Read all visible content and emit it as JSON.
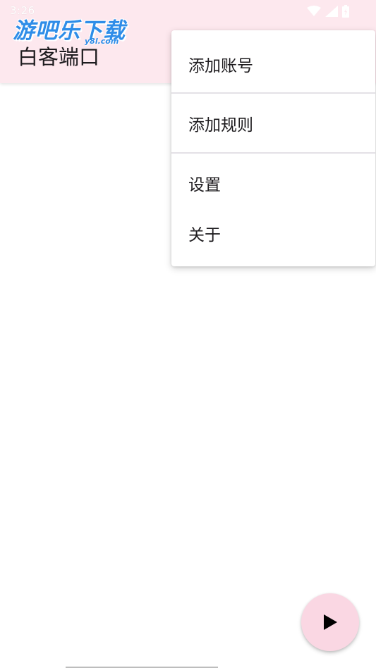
{
  "status_bar": {
    "time": "3:26",
    "icons": [
      "wifi-icon",
      "cellular-signal-icon",
      "battery-icon"
    ]
  },
  "watermark": {
    "title": "游吧乐下载",
    "subtitle": "y8l.com"
  },
  "app_bar": {
    "title": "白客端口"
  },
  "overflow_menu": {
    "items": [
      {
        "label": "添加账号"
      },
      {
        "label": "添加规则"
      },
      {
        "label": "设置"
      },
      {
        "label": "关于"
      }
    ]
  },
  "fab": {
    "icon": "play-icon"
  },
  "colors": {
    "app_bar_background": "#fde8ee",
    "fab_background": "#fad7e3",
    "text_primary": "#1d1b1e",
    "watermark_blue": "#2f8de8"
  }
}
